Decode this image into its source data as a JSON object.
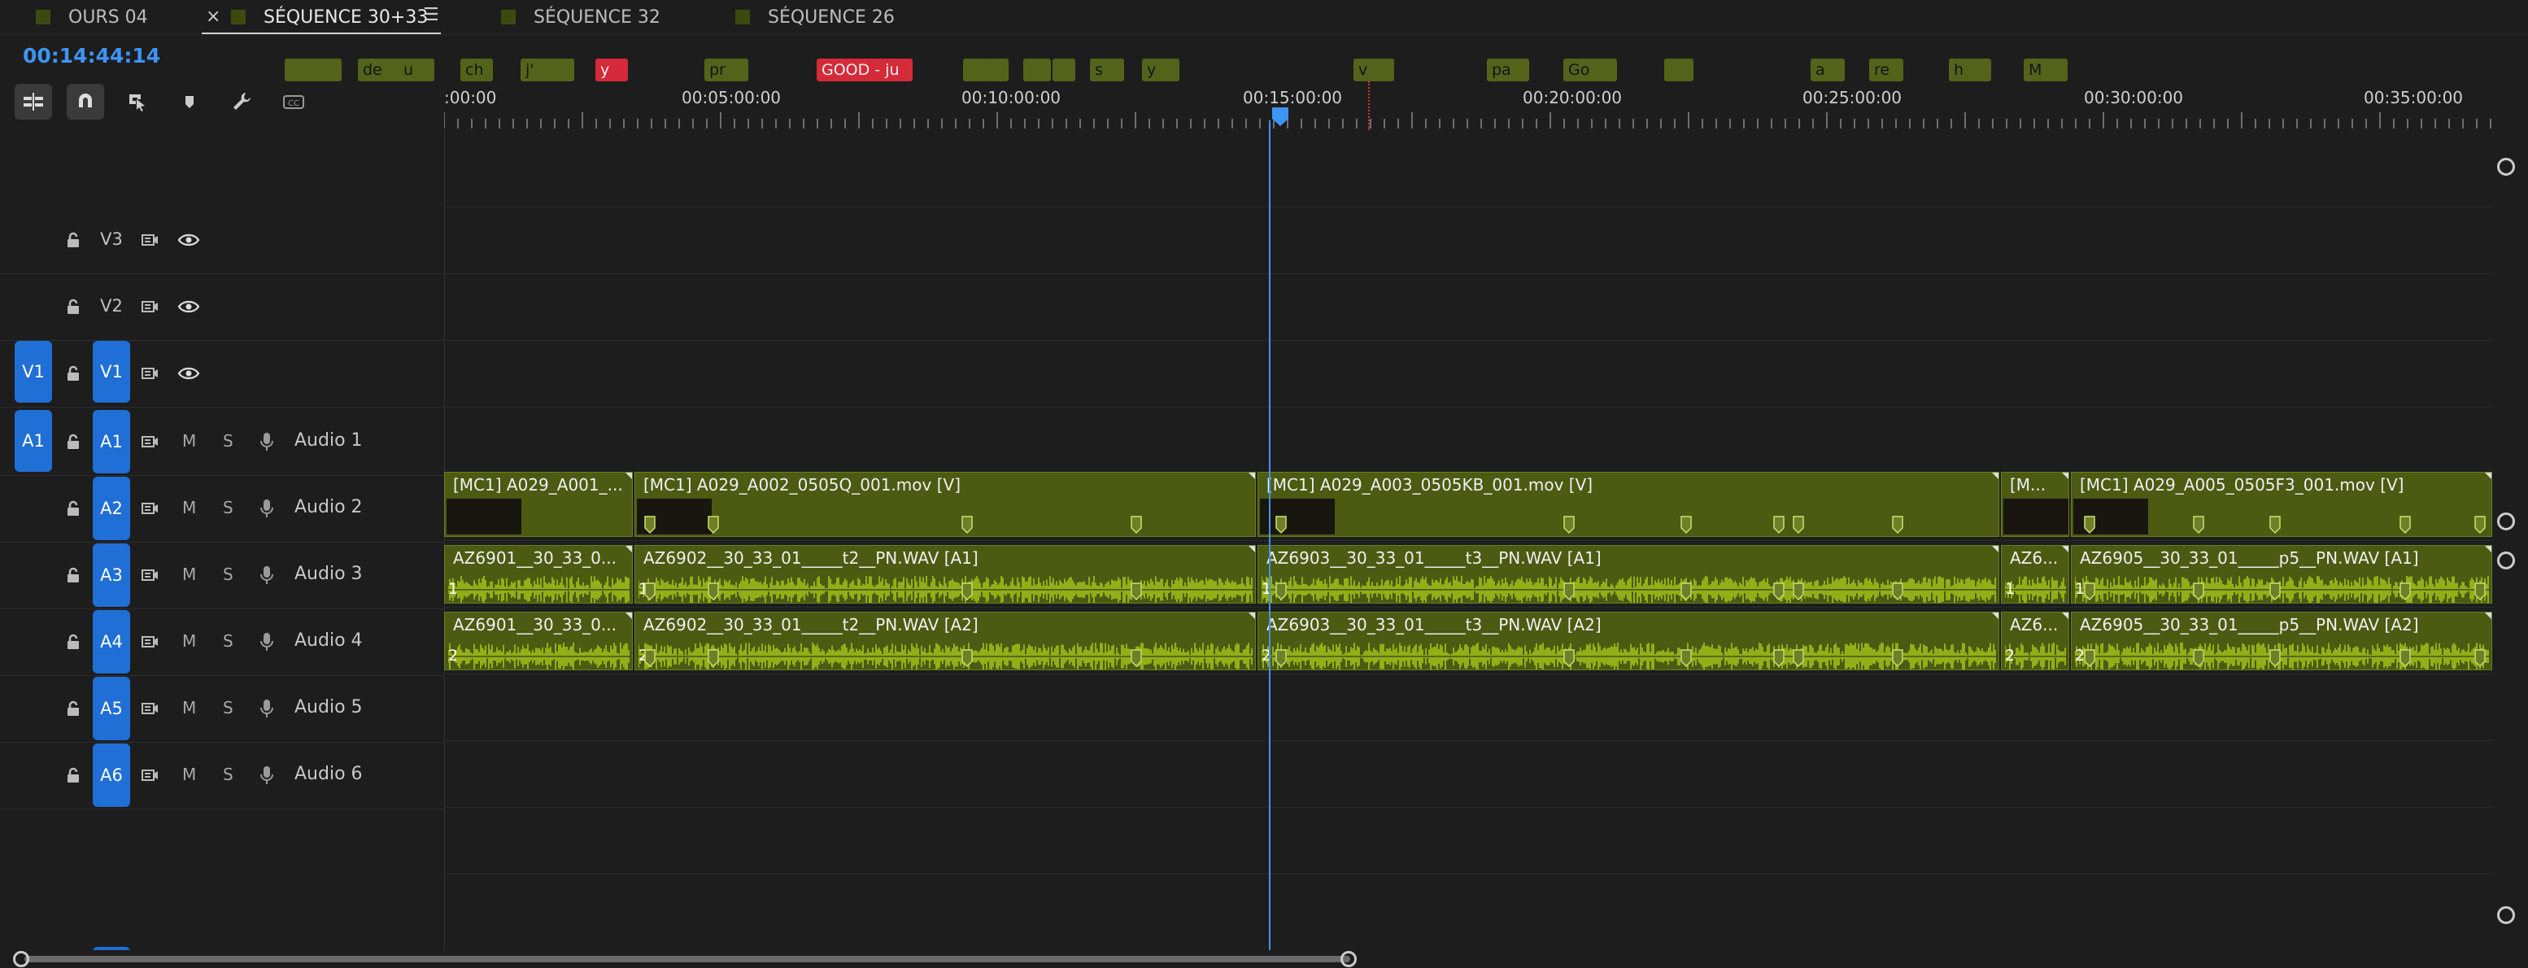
{
  "tabs": [
    {
      "label": "OURS 04"
    },
    {
      "label": "SÉQUENCE 30+33",
      "active": true
    },
    {
      "label": "SÉQUENCE 32"
    },
    {
      "label": "SÉQUENCE 26"
    }
  ],
  "tab_close": "×",
  "tab_menu": "☰",
  "timecode": "00:14:44:14",
  "toolbar": {
    "icons": [
      "insert-nest-icon",
      "snap-magnet-icon",
      "linked-selection-icon",
      "add-marker-icon",
      "wrench-settings-icon",
      "captions-icon"
    ],
    "captions_label": "CC"
  },
  "ruler": {
    "labels": [
      ":00:00",
      "00:05:00:00",
      "00:10:00:00",
      "00:15:00:00",
      "00:20:00:00",
      "00:25:00:00",
      "00:30:00:00",
      "00:35:00:00"
    ]
  },
  "markers": [
    {
      "text": "",
      "color": "#53641a"
    },
    {
      "text": "",
      "color": "#53641a"
    },
    {
      "text": "de",
      "color": "#53641a"
    },
    {
      "text": "u",
      "color": "#53641a"
    },
    {
      "text": "ch",
      "color": "#53641a"
    },
    {
      "text": "j'",
      "color": "#53641a"
    },
    {
      "text": "",
      "color": "#53641a"
    },
    {
      "text": "y",
      "color": "#d52a39"
    },
    {
      "text": "pr",
      "color": "#53641a"
    },
    {
      "text": "GOOD - ju",
      "color": "#d52a39"
    },
    {
      "text": "",
      "color": "#53641a"
    },
    {
      "text": "",
      "color": "#53641a"
    },
    {
      "text": "",
      "color": "#53641a"
    },
    {
      "text": "",
      "color": "#53641a"
    },
    {
      "text": "s",
      "color": "#53641a"
    },
    {
      "text": "y",
      "color": "#53641a"
    },
    {
      "text": "v",
      "color": "#53641a"
    },
    {
      "text": "pa",
      "color": "#53641a"
    },
    {
      "text": "Go",
      "color": "#53641a"
    },
    {
      "text": "",
      "color": "#53641a"
    },
    {
      "text": "a",
      "color": "#53641a"
    },
    {
      "text": "re",
      "color": "#53641a"
    },
    {
      "text": "h",
      "color": "#53641a"
    },
    {
      "text": "M",
      "color": "#53641a"
    }
  ],
  "video_tracks": [
    {
      "name": "V3",
      "source": ""
    },
    {
      "name": "V2",
      "source": ""
    },
    {
      "name": "V1",
      "source": "V1"
    }
  ],
  "audio_tracks": [
    {
      "name": "A1",
      "source": "A1",
      "label": "Audio 1"
    },
    {
      "name": "A2",
      "source": "",
      "label": "Audio 2"
    },
    {
      "name": "A3",
      "source": "",
      "label": "Audio 3"
    },
    {
      "name": "A4",
      "source": "",
      "label": "Audio 4"
    },
    {
      "name": "A5",
      "source": "",
      "label": "Audio 5"
    },
    {
      "name": "A6",
      "source": "",
      "label": "Audio 6"
    }
  ],
  "mute_label": "M",
  "solo_label": "S",
  "clips": {
    "v1": [
      "[MC1] A029_A001_...",
      "[MC1] A029_A002_0505Q_001.mov [V]",
      "[MC1] A029_A003_0505KB_001.mov [V]",
      "[M...",
      "[MC1] A029_A005_0505F3_001.mov [V]"
    ],
    "a1": [
      "AZ6901__30_33_0...",
      "AZ6902__30_33_01_____t2__PN.WAV [A1]",
      "AZ6903__30_33_01_____t3__PN.WAV [A1]",
      "AZ6...",
      "AZ6905__30_33_01_____p5__PN.WAV [A1]"
    ],
    "a2": [
      "AZ6901__30_33_0...",
      "AZ6902__30_33_01_____t2__PN.WAV [A2]",
      "AZ6903__30_33_01_____t3__PN.WAV [A2]",
      "AZ6...",
      "AZ6905__30_33_01_____p5__PN.WAV [A2]"
    ],
    "a1_channel": "1",
    "a2_channel": "2"
  },
  "colors": {
    "clip": "#4c5a12",
    "waveform": "#b4d21a",
    "playhead": "#3d95f5",
    "target": "#1f6fd6",
    "marker_red": "#d52a39"
  }
}
